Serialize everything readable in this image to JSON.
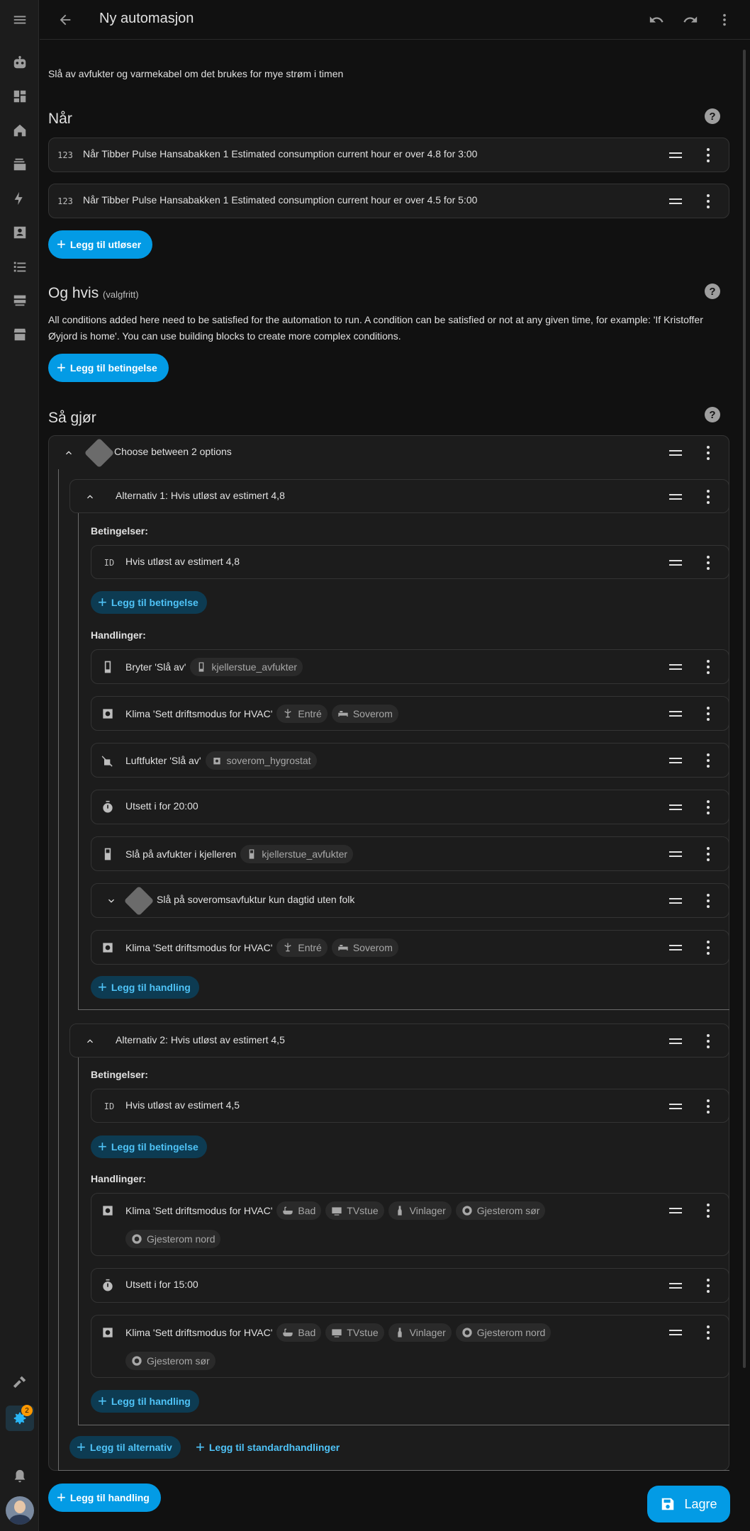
{
  "header": {
    "title": "Ny automasjon"
  },
  "description": "Slå av avfukter og varmekabel om det brukes for mye strøm i timen",
  "sidebar": {
    "badge": "2"
  },
  "triggers": {
    "title": "Når",
    "items": [
      {
        "icon": "123",
        "label": "Når Tibber Pulse Hansabakken 1 Estimated consumption current hour er over 4.8 for 3:00"
      },
      {
        "icon": "123",
        "label": "Når Tibber Pulse Hansabakken 1 Estimated consumption current hour er over 4.5 for 5:00"
      }
    ],
    "add_label": "Legg til utløser"
  },
  "conditions": {
    "title": "Og hvis",
    "optional": "(valgfritt)",
    "description": "All conditions added here need to be satisfied for the automation to run. A condition can be satisfied or not at any given time, for example: 'If Kristoffer Øyjord is home'. You can use building blocks to create more complex conditions.",
    "add_label": "Legg til betingelse"
  },
  "actions": {
    "title": "Så gjør",
    "choose": {
      "label": "Choose between 2 options"
    },
    "option1": {
      "label": "Alternativ 1: Hvis utløst av estimert 4,8",
      "conditions_heading": "Betingelser:",
      "condition": {
        "icon": "ID",
        "label": "Hvis utløst av estimert 4,8"
      },
      "add_condition": "Legg til betingelse",
      "actions_heading": "Handlinger:",
      "items": [
        {
          "label": "Bryter 'Slå av'",
          "chips": [
            "kjellerstue_avfukter"
          ]
        },
        {
          "label": "Klima 'Sett driftsmodus for HVAC'",
          "chips": [
            "Entré",
            "Soverom"
          ]
        },
        {
          "label": "Luftfukter 'Slå av'",
          "chips": [
            "soverom_hygrostat"
          ]
        },
        {
          "label": "Utsett i for 20:00",
          "chips": []
        },
        {
          "label": "Slå på avfukter i kjelleren",
          "chips": [
            "kjellerstue_avfukter"
          ]
        },
        {
          "label": "Slå på soveromsavfuktur kun dagtid uten folk",
          "chips": []
        },
        {
          "label": "Klima 'Sett driftsmodus for HVAC'",
          "chips": [
            "Entré",
            "Soverom"
          ]
        }
      ],
      "add_action": "Legg til handling"
    },
    "option2": {
      "label": "Alternativ 2: Hvis utløst av estimert 4,5",
      "conditions_heading": "Betingelser:",
      "condition": {
        "icon": "ID",
        "label": "Hvis utløst av estimert 4,5"
      },
      "add_condition": "Legg til betingelse",
      "actions_heading": "Handlinger:",
      "items": [
        {
          "label": "Klima 'Sett driftsmodus for HVAC'",
          "chips": [
            "Bad",
            "TVstue",
            "Vinlager",
            "Gjesterom sør",
            "Gjesterom nord"
          ]
        },
        {
          "label": "Utsett i for 15:00",
          "chips": []
        },
        {
          "label": "Klima 'Sett driftsmodus for HVAC'",
          "chips": [
            "Bad",
            "TVstue",
            "Vinlager",
            "Gjesterom nord",
            "Gjesterom sør"
          ]
        }
      ],
      "add_action": "Legg til handling"
    },
    "add_option": "Legg til alternativ",
    "add_default": "Legg til standardhandlinger",
    "add_label": "Legg til handling"
  },
  "save_label": "Lagre"
}
